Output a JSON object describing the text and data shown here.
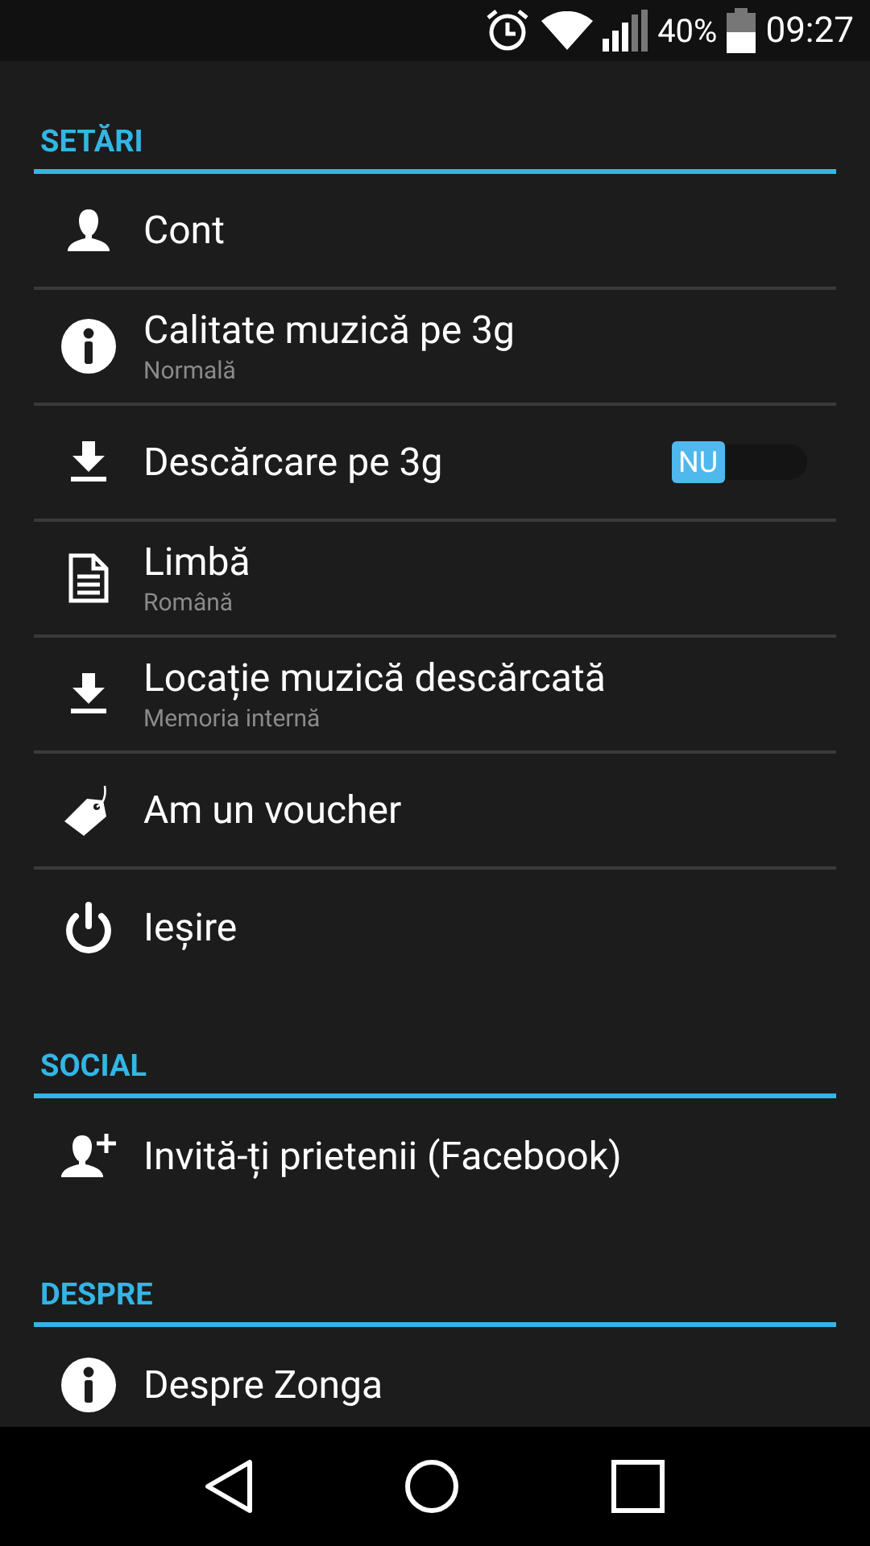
{
  "status_bar": {
    "battery": "40%",
    "time": "09:27"
  },
  "sections": [
    {
      "title": "SETĂRI",
      "items": [
        {
          "kind": "plain",
          "label": "Cont"
        },
        {
          "kind": "subtitle",
          "label": "Calitate muzică pe 3g",
          "subtitle": "Normală"
        },
        {
          "kind": "toggle",
          "label": "Descărcare pe 3g",
          "toggle_label": "NU",
          "on": false
        },
        {
          "kind": "subtitle",
          "label": "Limbă",
          "subtitle": "Română"
        },
        {
          "kind": "subtitle",
          "label": "Locație muzică descărcată",
          "subtitle": "Memoria internă"
        },
        {
          "kind": "plain",
          "label": "Am un voucher"
        },
        {
          "kind": "plain",
          "label": "Ieșire"
        }
      ]
    },
    {
      "title": "SOCIAL",
      "items": [
        {
          "kind": "plain",
          "label": "Invită-ți prietenii (Facebook)"
        }
      ]
    },
    {
      "title": "DESPRE",
      "items": [
        {
          "kind": "plain",
          "label": "Despre Zonga"
        }
      ]
    }
  ]
}
